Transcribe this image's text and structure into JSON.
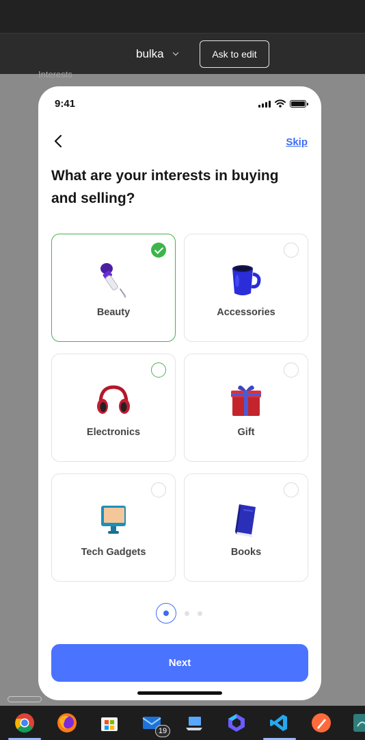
{
  "editor": {
    "project_name": "bulka",
    "ask_to_edit_label": "Ask to edit",
    "frame_label": "Interests"
  },
  "status_bar": {
    "time": "9:41"
  },
  "screen": {
    "skip_label": "Skip",
    "question": "What are your interests in buying and selling?",
    "next_label": "Next",
    "page_indicator": {
      "current": 1,
      "total": 3
    }
  },
  "categories": [
    {
      "label": "Beauty",
      "icon": "dropper-icon",
      "state": "checked"
    },
    {
      "label": "Accessories",
      "icon": "mug-icon",
      "state": "unchecked"
    },
    {
      "label": "Electronics",
      "icon": "headphones-icon",
      "state": "focused"
    },
    {
      "label": "Gift",
      "icon": "gift-icon",
      "state": "unchecked"
    },
    {
      "label": "Tech Gadgets",
      "icon": "monitor-icon",
      "state": "unchecked"
    },
    {
      "label": "Books",
      "icon": "book-icon",
      "state": "unchecked"
    }
  ],
  "taskbar": {
    "apps": [
      "chrome-icon",
      "firefox-icon",
      "microsoft-store-icon",
      "mail-icon",
      "laptop-icon",
      "copilot-icon",
      "vscode-icon",
      "paint-icon",
      "app-icon"
    ],
    "mail_badge": "19"
  },
  "colors": {
    "accent": "#4a73ff",
    "link": "#3d6df5",
    "selected": "#4caf50",
    "check": "#3bb54a"
  }
}
